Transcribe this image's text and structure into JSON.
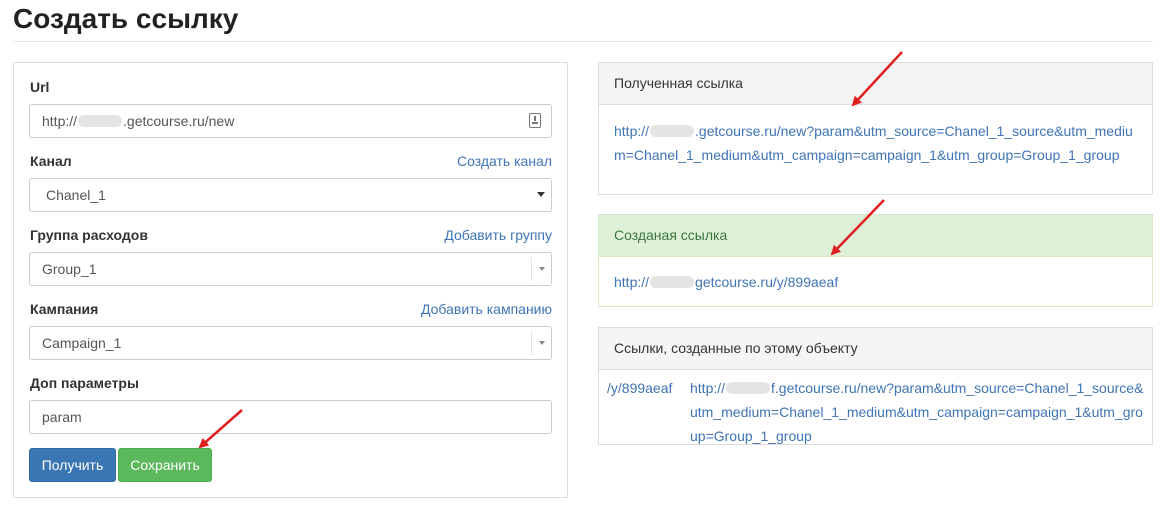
{
  "page": {
    "title": "Создать ссылку"
  },
  "form": {
    "url": {
      "label": "Url",
      "value_prefix": "http://",
      "value_suffix": ".getcourse.ru/new"
    },
    "channel": {
      "label": "Канал",
      "link": "Создать канал",
      "value": "Chanel_1"
    },
    "expense_group": {
      "label": "Группа расходов",
      "link": "Добавить группу",
      "value": "Group_1"
    },
    "campaign": {
      "label": "Кампания",
      "link": "Добавить кампанию",
      "value": "Campaign_1"
    },
    "extra_params": {
      "label": "Доп параметры",
      "value": "param"
    },
    "buttons": {
      "get": "Получить",
      "save": "Сохранить"
    }
  },
  "received_link": {
    "heading": "Полученная ссылка",
    "prefix": "http://",
    "rest": ".getcourse.ru/new?param&utm_source=Chanel_1_source&utm_medium=Chanel_1_medium&utm_campaign=campaign_1&utm_group=Group_1_group"
  },
  "created_link": {
    "heading": "Созданая ссылка",
    "prefix": "http://",
    "rest": "getcourse.ru/y/899aeaf"
  },
  "object_links": {
    "heading": "Ссылки, созданные по этому объекту",
    "rows": [
      {
        "short": "/y/899aeaf",
        "prefix": "http://",
        "rest": "f.getcourse.ru/new?param&utm_source=Chanel_1_source&utm_medium=Chanel_1_medium&utm_campaign=campaign_1&utm_group=Group_1_group"
      }
    ]
  },
  "colors": {
    "link": "#3f74b5",
    "primary": "#3a76b4",
    "success": "#5cb85c",
    "annotation_arrow": "#e02020"
  }
}
